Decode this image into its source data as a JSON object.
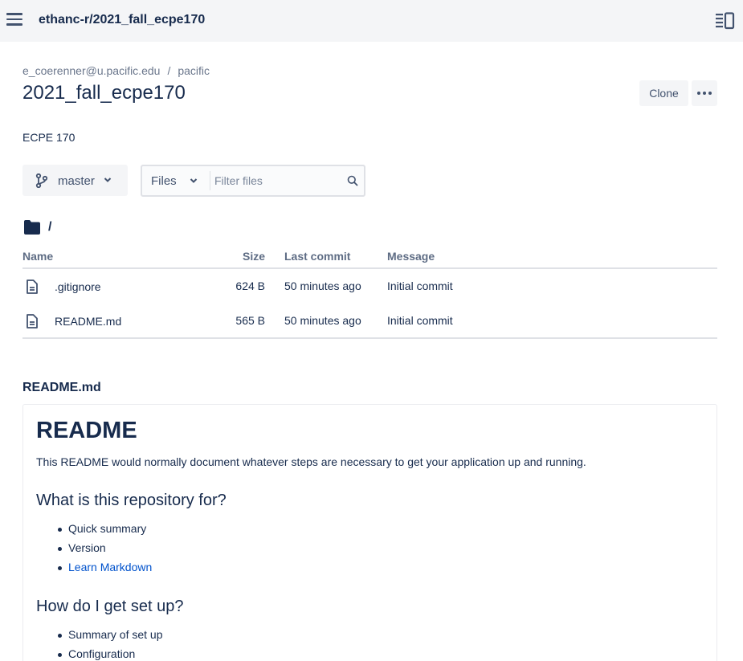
{
  "topbar": {
    "title": "ethanc-r/2021_fall_ecpe170"
  },
  "breadcrumb": {
    "owner": "e_coerenner@u.pacific.edu",
    "separator": "/",
    "project": "pacific"
  },
  "repo": {
    "title": "2021_fall_ecpe170",
    "description": "ECPE 170",
    "clone_label": "Clone"
  },
  "controls": {
    "branch": "master",
    "files_select": "Files",
    "filter_placeholder": "Filter files"
  },
  "path": "/",
  "table": {
    "headers": {
      "name": "Name",
      "size": "Size",
      "last_commit": "Last commit",
      "message": "Message"
    },
    "rows": [
      {
        "name": ".gitignore",
        "size": "624 B",
        "last_commit": "50 minutes ago",
        "message": "Initial commit"
      },
      {
        "name": "README.md",
        "size": "565 B",
        "last_commit": "50 minutes ago",
        "message": "Initial commit"
      }
    ]
  },
  "readme": {
    "file_label": "README.md",
    "h1": "README",
    "intro": "This README would normally document whatever steps are necessary to get your application up and running.",
    "sections": [
      {
        "heading": "What is this repository for?",
        "items": [
          "Quick summary",
          "Version",
          "Learn Markdown"
        ]
      },
      {
        "heading": "How do I get set up?",
        "items": [
          "Summary of set up",
          "Configuration"
        ]
      }
    ]
  },
  "colors": {
    "topbar_bg": "#f4f5f7",
    "text": "#172b4d",
    "muted": "#6b778c",
    "link": "#0052cc",
    "border": "#dfe1e6"
  }
}
